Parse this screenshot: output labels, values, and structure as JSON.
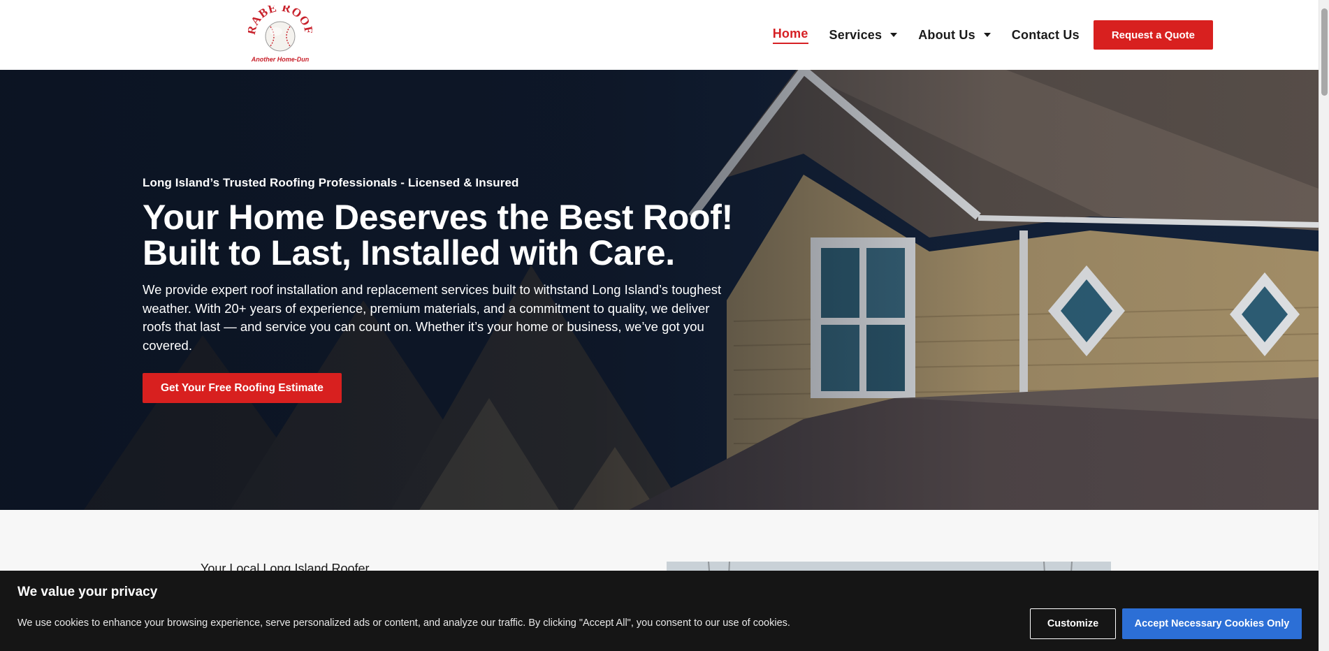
{
  "brand": {
    "logo_text": "RABE ROOF",
    "tagline": "Another Home-Dun"
  },
  "nav": {
    "items": [
      {
        "label": "Home",
        "active": true,
        "dropdown": false
      },
      {
        "label": "Services",
        "active": false,
        "dropdown": true
      },
      {
        "label": "About Us",
        "active": false,
        "dropdown": true
      },
      {
        "label": "Contact Us",
        "active": false,
        "dropdown": false
      }
    ],
    "quote_button": "Request a Quote"
  },
  "hero": {
    "eyebrow": "Long Island’s Trusted Roofing Professionals - Licensed & Insured",
    "headline_line1": "Your Home Deserves the Best Roof!",
    "headline_line2": "Built to Last, Installed with Care.",
    "description": "We provide expert roof installation and replacement services built to withstand Long Island’s toughest weather. With 20+ years of experience, premium materials, and a commitment to quality, we deliver roofs that last — and service you can count on. Whether it’s your home or business, we’ve got you covered.",
    "cta": "Get Your Free Roofing Estimate"
  },
  "section2": {
    "eyebrow": "Your Local Long Island Roofer"
  },
  "cookie": {
    "title": "We value your privacy",
    "text": "We use cookies to enhance your browsing experience, serve personalized ads or content, and analyze our traffic. By clicking \"Accept All\", you consent to our use of cookies.",
    "customize": "Customize",
    "accept": "Accept Necessary Cookies Only"
  },
  "colors": {
    "brand_red": "#d8201f",
    "nav_active": "#d62024",
    "accept_blue": "#2c6fd6",
    "banner_bg": "#151515"
  }
}
